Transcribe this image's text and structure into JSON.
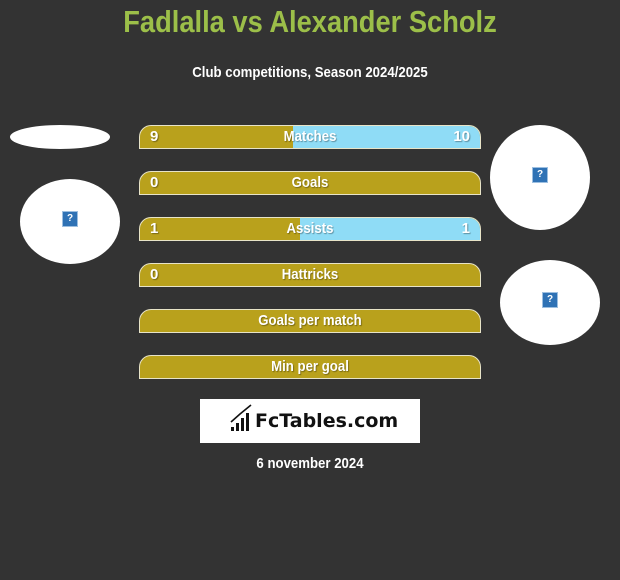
{
  "header": {
    "title": "Fadlalla vs Alexander Scholz",
    "subtitle": "Club competitions, Season 2024/2025"
  },
  "players": {
    "left": {
      "name": "Fadlalla",
      "image_icon": "broken-image-icon",
      "icon_glyph": "?"
    },
    "right": {
      "name": "Alexander Scholz",
      "image_icon": "broken-image-icon",
      "icon_glyph": "?"
    }
  },
  "colors": {
    "left_bar": "#b9a11c",
    "right_bar": "#8fdcf6",
    "title": "#9cbf49",
    "background": "#333333"
  },
  "stats": [
    {
      "label": "Matches",
      "left": "9",
      "right": "10",
      "right_share": 0.55
    },
    {
      "label": "Goals",
      "left": "0",
      "right": "",
      "right_share": 0
    },
    {
      "label": "Assists",
      "left": "1",
      "right": "1",
      "right_share": 0.53
    },
    {
      "label": "Hattricks",
      "left": "0",
      "right": "",
      "right_share": 0
    },
    {
      "label": "Goals per match",
      "left": "",
      "right": "",
      "right_share": 0
    },
    {
      "label": "Min per goal",
      "left": "",
      "right": "",
      "right_share": 0
    }
  ],
  "logo": {
    "text": "FcTables.com",
    "icon": "bar-chart-icon"
  },
  "date": "6 november 2024"
}
